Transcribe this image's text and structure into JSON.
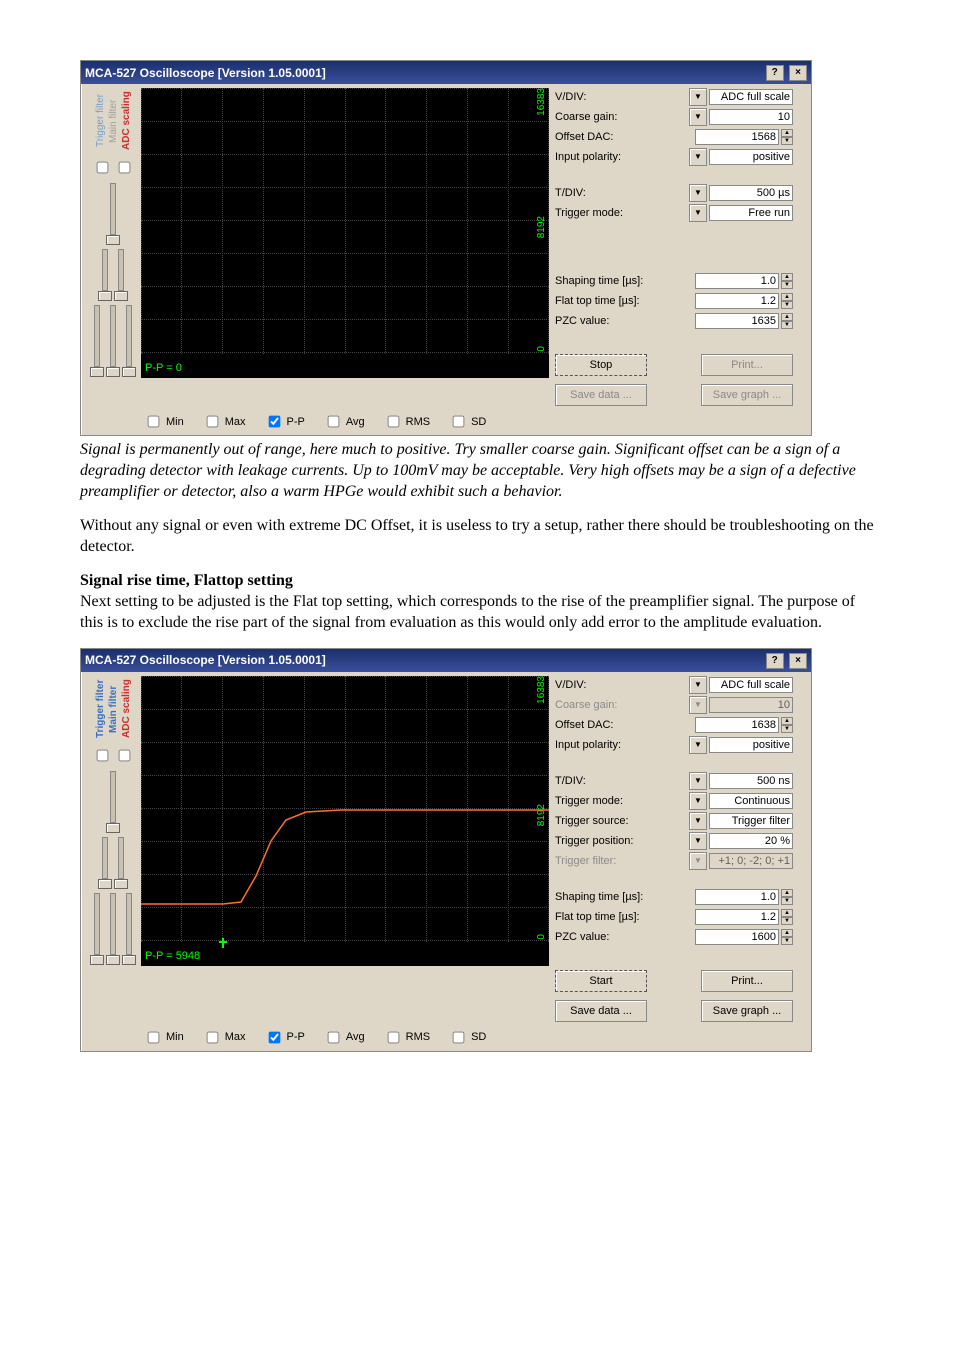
{
  "window_title": "MCA-527 Oscilloscope [Version 1.05.0001]",
  "titlebar_help": "?",
  "titlebar_close": "×",
  "side_labels": {
    "trigger": "Trigger filter",
    "main": "Main filter",
    "adc": "ADC scaling"
  },
  "pp_label": "P-P = ",
  "ylabels": {
    "top": "16383",
    "mid": "8192",
    "bottom": "0"
  },
  "footer": {
    "min": "Min",
    "max": "Max",
    "pp": "P-P",
    "avg": "Avg",
    "rms": "RMS",
    "sd": "SD"
  },
  "panel_labels": {
    "vdiv": "V/DIV:",
    "coarse": "Coarse gain:",
    "offset": "Offset DAC:",
    "polarity": "Input polarity:",
    "tdiv": "T/DIV:",
    "tmode": "Trigger mode:",
    "tsource": "Trigger source:",
    "tpos": "Trigger position:",
    "tfilter": "Trigger filter:",
    "shaping": "Shaping time [µs]:",
    "flattop": "Flat top time [µs]:",
    "pzc": "PZC value:"
  },
  "buttons": {
    "stop": "Stop",
    "start": "Start",
    "print": "Print...",
    "savedata": "Save data ...",
    "savegraph": "Save graph ..."
  },
  "scope1": {
    "pp_value": "0",
    "panel": {
      "vdiv": "ADC full scale",
      "coarse": "10",
      "offset": "1568",
      "polarity": "positive",
      "tdiv": "500 µs",
      "tmode": "Free run",
      "shaping": "1.0",
      "flattop": "1.2",
      "pzc": "1635"
    }
  },
  "scope2": {
    "pp_value": "5948",
    "panel": {
      "vdiv": "ADC full scale",
      "coarse": "10",
      "offset": "1638",
      "polarity": "positive",
      "tdiv": "500 ns",
      "tmode": "Continuous",
      "tsource": "Trigger filter",
      "tpos": "20 %",
      "tfilter": "+1; 0; -2; 0; +1",
      "shaping": "1.0",
      "flattop": "1.2",
      "pzc": "1600"
    }
  },
  "caption1": "Signal is permanently out of range, here much to positive. Try smaller coarse gain. Significant offset can be a sign of a degrading detector with leakage currents. Up to 100mV may be acceptable. Very high offsets may be a sign of a defective preamplifier or detector, also a warm HPGe would exhibit such a behavior.",
  "para1": "Without any signal or even with extreme DC Offset, it is useless to try a setup, rather there should be troubleshooting on the detector.",
  "heading1": "Signal rise time, Flattop setting",
  "para2": "Next setting to be adjusted is the Flat top setting, which corresponds to the rise of the preamplifier signal. The purpose of this is to exclude the rise part of the signal from evaluation as this would only add error to the amplitude evaluation."
}
